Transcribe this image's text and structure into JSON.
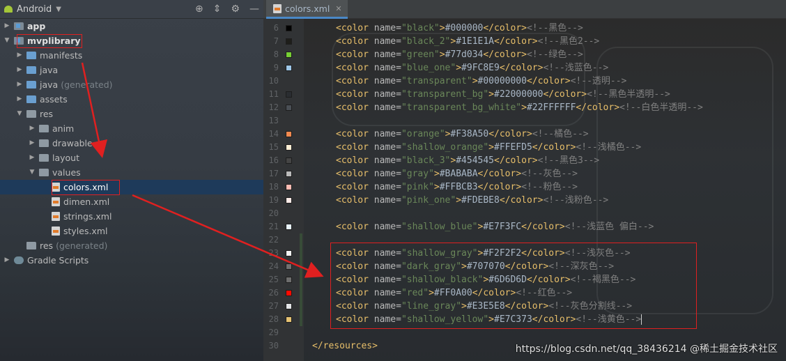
{
  "project_panel": {
    "title": "Android",
    "tree": [
      {
        "label": "app",
        "generated": "",
        "indent": 0,
        "toggle": "▶",
        "icon": "module-folder-icon",
        "bold": true
      },
      {
        "label": "mvplibrary",
        "generated": "",
        "indent": 0,
        "toggle": "▼",
        "icon": "module-folder-icon",
        "bold": true
      },
      {
        "label": "manifests",
        "generated": "",
        "indent": 1,
        "toggle": "▶",
        "icon": "folder-icon"
      },
      {
        "label": "java",
        "generated": "",
        "indent": 1,
        "toggle": "▶",
        "icon": "folder-icon"
      },
      {
        "label": "java",
        "generated": "(generated)",
        "indent": 1,
        "toggle": "▶",
        "icon": "folder-icon"
      },
      {
        "label": "assets",
        "generated": "",
        "indent": 1,
        "toggle": "▶",
        "icon": "folder-icon"
      },
      {
        "label": "res",
        "generated": "",
        "indent": 1,
        "toggle": "▼",
        "icon": "folder-icon"
      },
      {
        "label": "anim",
        "generated": "",
        "indent": 2,
        "toggle": "▶",
        "icon": "folder-icon"
      },
      {
        "label": "drawable",
        "generated": "",
        "indent": 2,
        "toggle": "▶",
        "icon": "folder-icon"
      },
      {
        "label": "layout",
        "generated": "",
        "indent": 2,
        "toggle": "▶",
        "icon": "folder-icon"
      },
      {
        "label": "values",
        "generated": "",
        "indent": 2,
        "toggle": "▼",
        "icon": "folder-icon"
      },
      {
        "label": "colors.xml",
        "generated": "",
        "indent": 3,
        "toggle": "",
        "icon": "xml-file-icon",
        "selected": true
      },
      {
        "label": "dimen.xml",
        "generated": "",
        "indent": 3,
        "toggle": "",
        "icon": "xml-file-icon"
      },
      {
        "label": "strings.xml",
        "generated": "",
        "indent": 3,
        "toggle": "",
        "icon": "xml-file-icon"
      },
      {
        "label": "styles.xml",
        "generated": "",
        "indent": 3,
        "toggle": "",
        "icon": "xml-file-icon"
      },
      {
        "label": "res",
        "generated": "(generated)",
        "indent": 1,
        "toggle": "",
        "icon": "folder-icon"
      },
      {
        "label": "Gradle Scripts",
        "generated": "",
        "indent": 0,
        "toggle": "▶",
        "icon": "gradle-icon"
      }
    ]
  },
  "editor": {
    "tab_label": "colors.xml",
    "lines": [
      {
        "n": "6",
        "swatch": "#000000",
        "name": "black",
        "value": "#000000",
        "comment": "黑色"
      },
      {
        "n": "7",
        "swatch": "#1E1E1A",
        "name": "black_2",
        "value": "#1E1E1A",
        "comment": "黑色2"
      },
      {
        "n": "8",
        "swatch": "#77d034",
        "name": "green",
        "value": "#77d034",
        "comment": "绿色"
      },
      {
        "n": "9",
        "swatch": "#9FC8E9",
        "name": "blue_one",
        "value": "#9FC8E9",
        "comment": "浅蓝色"
      },
      {
        "n": "10",
        "swatch": "",
        "name": "transparent",
        "value": "#00000000",
        "comment": "透明"
      },
      {
        "n": "11",
        "swatch": "#2a2d31",
        "name": "transparent_bg",
        "value": "#22000000",
        "comment": "黑色半透明"
      },
      {
        "n": "12",
        "swatch": "#4a4f55",
        "name": "transparent_bg_white",
        "value": "#22FFFFFF",
        "comment": "白色半透明"
      },
      {
        "n": "13",
        "swatch": "",
        "name": "",
        "value": "",
        "comment": ""
      },
      {
        "n": "14",
        "swatch": "#F38A50",
        "name": "orange",
        "value": "#F38A50",
        "comment": "橘色"
      },
      {
        "n": "15",
        "swatch": "#FFEFD5",
        "name": "shallow_orange",
        "value": "#FFEFD5",
        "comment": "浅橘色"
      },
      {
        "n": "16",
        "swatch": "#454545",
        "name": "black_3",
        "value": "#454545",
        "comment": "黑色3"
      },
      {
        "n": "17",
        "swatch": "#BABABA",
        "name": "gray",
        "value": "#BABABA",
        "comment": "灰色"
      },
      {
        "n": "18",
        "swatch": "#FFBCB3",
        "name": "pink",
        "value": "#FFBCB3",
        "comment": "粉色"
      },
      {
        "n": "19",
        "swatch": "#FDEBE8",
        "name": "pink_one",
        "value": "#FDEBE8",
        "comment": "浅粉色"
      },
      {
        "n": "20",
        "swatch": "",
        "name": "",
        "value": "",
        "comment": ""
      },
      {
        "n": "21",
        "swatch": "#E7F3FC",
        "name": "shallow_blue",
        "value": "#E7F3FC",
        "comment": "浅蓝色 偏白"
      },
      {
        "n": "22",
        "swatch": "",
        "name": "",
        "value": "",
        "comment": ""
      },
      {
        "n": "23",
        "swatch": "#F2F2F2",
        "name": "shallow_gray",
        "value": "#F2F2F2",
        "comment": "浅灰色"
      },
      {
        "n": "24",
        "swatch": "#707070",
        "name": "dark_gray",
        "value": "#707070",
        "comment": "深灰色"
      },
      {
        "n": "25",
        "swatch": "#6D6D6D",
        "name": "shallow_black",
        "value": "#6D6D6D",
        "comment": "褐黑色"
      },
      {
        "n": "26",
        "swatch": "#FF0A00",
        "name": "red",
        "value": "#FF0A00",
        "comment": "红色"
      },
      {
        "n": "27",
        "swatch": "#E3E5E8",
        "name": "line_gray",
        "value": "#E3E5E8",
        "comment": "灰色分割线"
      },
      {
        "n": "28",
        "swatch": "#E7C373",
        "name": "shallow_yellow",
        "value": "#E7C373",
        "comment": "浅黄色"
      },
      {
        "n": "29",
        "swatch": "",
        "name": "",
        "value": "",
        "comment": ""
      },
      {
        "n": "30",
        "swatch": "",
        "name": "",
        "value": "",
        "comment": "",
        "closing": "</resources>"
      }
    ]
  },
  "watermark": "https://blog.csdn.net/qq_38436214 @稀土掘金技术社区",
  "colors": {
    "annotation_red": "#e02020",
    "tag": "#e8bf6a",
    "attr_value": "#6a8759",
    "comment": "#808080"
  }
}
